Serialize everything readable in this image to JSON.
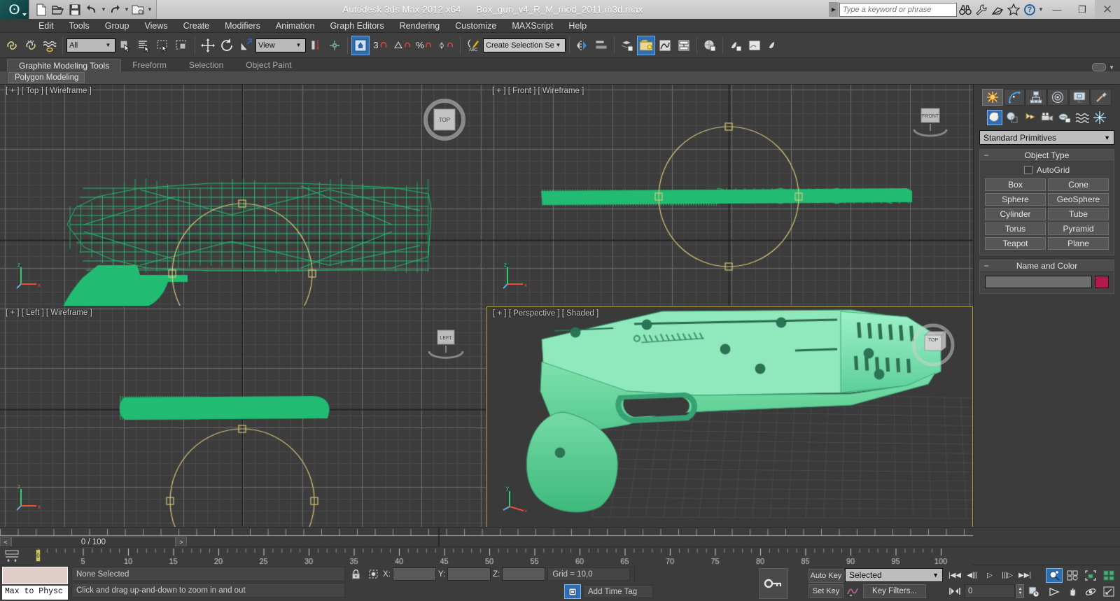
{
  "titlebar": {
    "app_title": "Autodesk 3ds Max  2012 x64",
    "file_name": "Box_gun_v4_R_M_mod_2011.m3d.max",
    "quick_access": [
      {
        "name": "new-file-icon",
        "label": "New"
      },
      {
        "name": "open-file-icon",
        "label": "Open"
      },
      {
        "name": "save-file-icon",
        "label": "Save"
      },
      {
        "name": "undo-icon",
        "label": "Undo"
      },
      {
        "name": "redo-icon",
        "label": "Redo"
      },
      {
        "name": "project-folder-icon",
        "label": "Set Project Folder"
      }
    ],
    "search_placeholder": "Type a keyword or phrase",
    "help_icons": [
      "binoculars-icon",
      "wrench-icon",
      "satellite-icon",
      "star-icon",
      "help-icon"
    ],
    "window_buttons": {
      "minimize": "—",
      "restore": "❐",
      "close": "✕"
    }
  },
  "menubar": {
    "items": [
      "Edit",
      "Tools",
      "Group",
      "Views",
      "Create",
      "Modifiers",
      "Animation",
      "Graph Editors",
      "Rendering",
      "Customize",
      "MAXScript",
      "Help"
    ]
  },
  "toolbar": {
    "selection_filter": "All",
    "reference_coord": "View",
    "named_selection_set": "Create Selection Se",
    "snap_count": "3",
    "items": [
      {
        "name": "select-link-button",
        "title": "Select and Link"
      },
      {
        "name": "unlink-selection-button",
        "title": "Unlink Selection"
      },
      {
        "name": "bind-space-warp-button",
        "title": "Bind to Space Warp"
      },
      {
        "name": "select-object-button",
        "title": "Select Object"
      },
      {
        "name": "select-by-name-button",
        "title": "Select by Name"
      },
      {
        "name": "rectangular-selection-region-button",
        "title": "Rectangular Selection Region"
      },
      {
        "name": "window-crossing-button",
        "title": "Window / Crossing"
      },
      {
        "name": "select-and-move-button",
        "title": "Select and Move"
      },
      {
        "name": "select-and-rotate-button",
        "title": "Select and Rotate"
      },
      {
        "name": "select-and-scale-button",
        "title": "Select and Uniform Scale"
      },
      {
        "name": "use-center-flyout-button",
        "title": "Use Pivot Point Center"
      },
      {
        "name": "select-and-manipulate-button",
        "title": "Select and Manipulate"
      },
      {
        "name": "snap-toggle-button",
        "title": "Snaps Toggle"
      },
      {
        "name": "angle-snap-button",
        "title": "Angle Snap Toggle"
      },
      {
        "name": "percent-snap-button",
        "title": "Percent Snap Toggle"
      },
      {
        "name": "spinner-snap-button",
        "title": "Spinner Snap Toggle"
      },
      {
        "name": "edit-named-selection-button",
        "title": "Edit Named Selection Sets"
      },
      {
        "name": "mirror-button",
        "title": "Mirror"
      },
      {
        "name": "align-button",
        "title": "Align"
      },
      {
        "name": "layer-manager-button",
        "title": "Layer Manager"
      },
      {
        "name": "graphite-toggle-button",
        "title": "Toggle Ribbon"
      },
      {
        "name": "curve-editor-button",
        "title": "Curve Editor"
      },
      {
        "name": "schematic-view-button",
        "title": "Schematic View"
      },
      {
        "name": "material-editor-button",
        "title": "Material Editor"
      },
      {
        "name": "render-setup-button",
        "title": "Render Setup"
      },
      {
        "name": "rendered-frame-button",
        "title": "Rendered Frame Window"
      },
      {
        "name": "render-production-button",
        "title": "Render Production"
      }
    ]
  },
  "ribbon": {
    "tabs": [
      {
        "label": "Graphite Modeling Tools",
        "active": true
      },
      {
        "label": "Freeform",
        "active": false
      },
      {
        "label": "Selection",
        "active": false
      },
      {
        "label": "Object Paint",
        "active": false
      }
    ],
    "panel_label": "Polygon Modeling"
  },
  "viewports": [
    {
      "name": "viewport-top",
      "label": "[ + ] [ Top ] [ Wireframe ]",
      "view": "Top",
      "shading": "Wireframe",
      "active": false,
      "cube_label": "TOP"
    },
    {
      "name": "viewport-front",
      "label": "[ + ] [ Front ] [ Wireframe ]",
      "view": "Front",
      "shading": "Wireframe",
      "active": false,
      "cube_label": "FRONT"
    },
    {
      "name": "viewport-left",
      "label": "[ + ] [ Left ] [ Wireframe ]",
      "view": "Left",
      "shading": "Wireframe",
      "active": false,
      "cube_label": "LEFT"
    },
    {
      "name": "viewport-perspective",
      "label": "[ + ] [ Perspective ] [ Shaded ]",
      "view": "Perspective",
      "shading": "Shaded",
      "active": true,
      "cube_label": "TOP"
    }
  ],
  "command_panel": {
    "tabs": [
      {
        "name": "create-tab",
        "label": "Create",
        "active": true
      },
      {
        "name": "modify-tab",
        "label": "Modify",
        "active": false
      },
      {
        "name": "hierarchy-tab",
        "label": "Hierarchy",
        "active": false
      },
      {
        "name": "motion-tab",
        "label": "Motion",
        "active": false
      },
      {
        "name": "display-tab",
        "label": "Display",
        "active": false
      },
      {
        "name": "utilities-tab",
        "label": "Utilities",
        "active": false
      }
    ],
    "category_buttons": [
      {
        "name": "geometry-button",
        "label": "Geometry",
        "active": true
      },
      {
        "name": "shapes-button",
        "label": "Shapes",
        "active": false
      },
      {
        "name": "lights-button",
        "label": "Lights",
        "active": false
      },
      {
        "name": "cameras-button",
        "label": "Cameras",
        "active": false
      },
      {
        "name": "helpers-button",
        "label": "Helpers",
        "active": false
      },
      {
        "name": "space-warps-button",
        "label": "Space Warps",
        "active": false
      },
      {
        "name": "systems-button",
        "label": "Systems",
        "active": false
      }
    ],
    "category_dropdown": "Standard Primitives",
    "object_type": {
      "title": "Object Type",
      "autogrid_label": "AutoGrid",
      "autogrid_checked": false,
      "buttons": [
        "Box",
        "Cone",
        "Sphere",
        "GeoSphere",
        "Cylinder",
        "Tube",
        "Torus",
        "Pyramid",
        "Teapot",
        "Plane"
      ]
    },
    "name_and_color": {
      "title": "Name and Color",
      "name_value": "",
      "color": "#b31a4b"
    }
  },
  "timeline": {
    "frame_field": "0 / 100",
    "prev_arrow": "<",
    "next_arrow": ">",
    "ruler_ticks": [
      "5",
      "10",
      "15",
      "20",
      "25",
      "30",
      "35",
      "40",
      "45",
      "50",
      "55",
      "60",
      "65",
      "70",
      "75",
      "80",
      "85",
      "90",
      "95",
      "100"
    ],
    "current_frame": 0,
    "range_max": 100
  },
  "statusbar": {
    "mtp_label": "Max to Physc",
    "selection_status": "None Selected",
    "prompt": "Click and drag up-and-down to zoom in and out",
    "lock_icon": "lock-icon",
    "selection_lock_icon": "selection-lock-icon",
    "coords": {
      "x_label": "X:",
      "x_value": "",
      "y_label": "Y:",
      "y_value": "",
      "z_label": "Z:",
      "z_value": ""
    },
    "grid_text": "Grid = 10,0",
    "add_time_tag": "Add Time Tag",
    "auto_key": "Auto Key",
    "set_key": "Set Key",
    "key_mode": "Selected",
    "key_filters": "Key Filters...",
    "key_frame_value": "0",
    "playback": [
      {
        "name": "go-to-start-button",
        "glyph": "|◀◀"
      },
      {
        "name": "previous-frame-button",
        "glyph": "◀|||"
      },
      {
        "name": "play-animation-button",
        "glyph": "▷"
      },
      {
        "name": "next-frame-button",
        "glyph": "|||▷"
      },
      {
        "name": "go-to-end-button",
        "glyph": "▶▶|"
      }
    ],
    "nav_buttons": [
      {
        "name": "zoom-button",
        "active": true
      },
      {
        "name": "zoom-all-button",
        "active": false
      },
      {
        "name": "zoom-extents-button",
        "active": false
      },
      {
        "name": "zoom-extents-all-button",
        "active": false
      },
      {
        "name": "field-of-view-button",
        "active": false
      },
      {
        "name": "pan-view-button",
        "active": false
      },
      {
        "name": "orbit-button",
        "active": false
      },
      {
        "name": "maximize-viewport-toggle-button",
        "active": false
      }
    ]
  },
  "colors": {
    "accent_blue": "#2d6fb5",
    "wireframe_green": "#22bb72",
    "shaded_green": "#7fe0b2",
    "active_viewport_border": "#b7a04a",
    "gizmo_yellow": "#d9c87a"
  }
}
